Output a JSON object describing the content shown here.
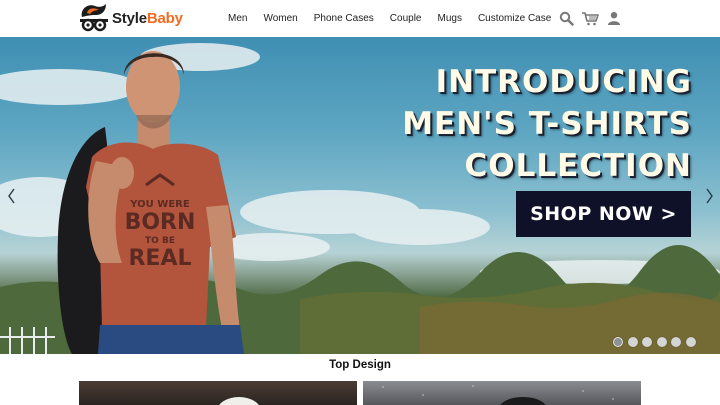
{
  "brand": {
    "name_part1": "Style",
    "name_part2": "Baby",
    "accent_color": "#f26b21"
  },
  "nav": {
    "items": [
      {
        "label": "Men"
      },
      {
        "label": "Women"
      },
      {
        "label": "Phone Cases"
      },
      {
        "label": "Couple"
      },
      {
        "label": "Mugs"
      },
      {
        "label": "Customize Case"
      }
    ]
  },
  "tools": {
    "icons": [
      "search-icon",
      "cart-icon",
      "user-icon"
    ]
  },
  "hero": {
    "headline": [
      "INTRODUCING",
      "MEN'S T-SHIRTS",
      "COLLECTION"
    ],
    "cta_label": "SHOP NOW >",
    "shirt_print": [
      "YOU WERE",
      "BORN",
      "TO BE",
      "REAL"
    ],
    "slide_count": 6,
    "active_slide": 1
  },
  "section": {
    "title": "Top Design"
  }
}
